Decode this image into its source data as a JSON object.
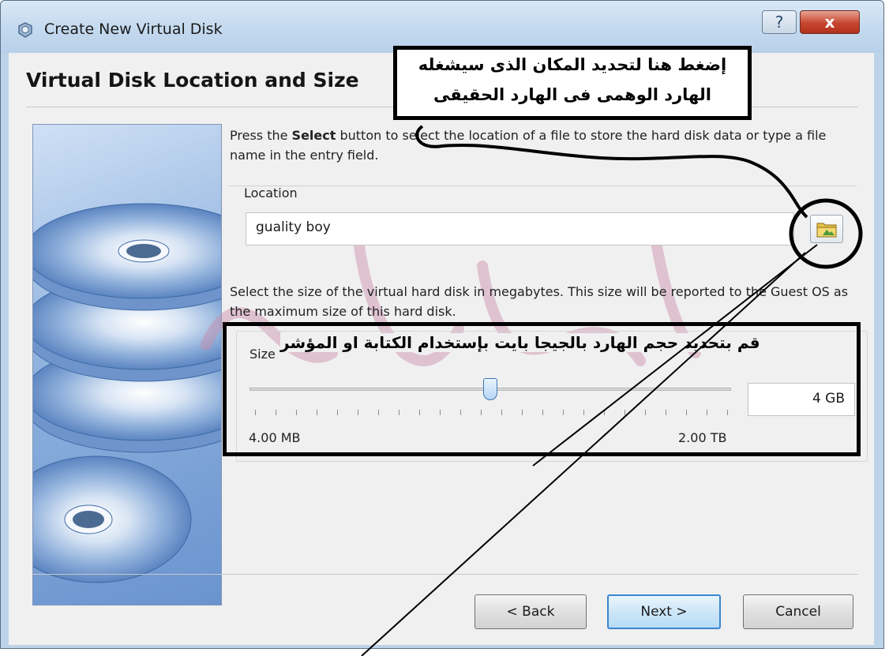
{
  "window": {
    "title": "Create New Virtual Disk",
    "help_glyph": "?",
    "close_glyph": "x"
  },
  "page": {
    "heading": "Virtual Disk Location and Size",
    "location_instruction_pre": "Press the ",
    "location_instruction_bold": "Select",
    "location_instruction_post": " button to select the location of a file to store the hard disk data or type a file name in the entry field.",
    "size_instruction": "Select the size of the virtual hard disk in megabytes. This size will be reported to the Guest OS as the maximum size of this hard disk."
  },
  "location": {
    "label": "Location",
    "value": "guality boy",
    "select_button_icon": "folder-icon"
  },
  "size": {
    "label": "Size",
    "value": "4 GB",
    "min_label": "4.00 MB",
    "max_label": "2.00 TB",
    "slider_fraction": 0.5
  },
  "buttons": {
    "back": "< Back",
    "next": "Next >",
    "cancel": "Cancel"
  },
  "annotations": {
    "top_line1": "إضغط هنا لتحديد المكان الذى سيشغله",
    "top_line2": "الهارد الوهمى فى الهارد الحقيقى",
    "size_note": "قم بتحديد حجم الهارد بالجيجا بايت بإستخدام الكتابة او المؤشر"
  },
  "colors": {
    "accent": "#3a86d0",
    "close_red": "#c7462f",
    "watermark": "#c98aa8"
  }
}
